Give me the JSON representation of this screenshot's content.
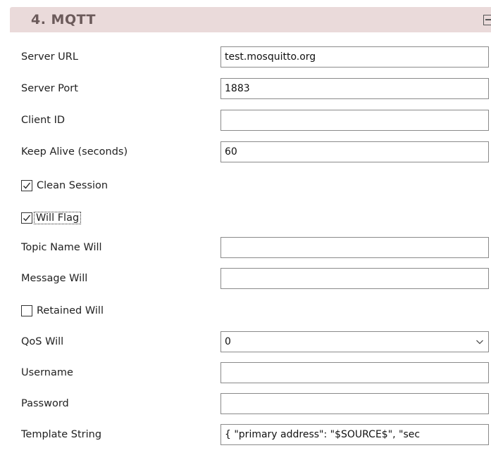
{
  "section": {
    "title": "4. MQTT",
    "collapse_icon": "collapse-icon"
  },
  "fields": {
    "server_url": {
      "label": "Server URL",
      "value": "test.mosquitto.org"
    },
    "server_port": {
      "label": "Server Port",
      "value": "1883"
    },
    "client_id": {
      "label": "Client ID",
      "value": ""
    },
    "keep_alive": {
      "label": "Keep Alive (seconds)",
      "value": "60"
    },
    "clean_session": {
      "label": "Clean Session",
      "checked": true
    },
    "will_flag": {
      "label": "Will Flag",
      "checked": true
    },
    "topic_name_will": {
      "label": "Topic Name Will",
      "value": ""
    },
    "message_will": {
      "label": "Message Will",
      "value": ""
    },
    "retained_will": {
      "label": "Retained Will",
      "checked": false
    },
    "qos_will": {
      "label": "QoS Will",
      "value": "0"
    },
    "username": {
      "label": "Username",
      "value": ""
    },
    "password": {
      "label": "Password",
      "value": ""
    },
    "template_string": {
      "label": "Template String",
      "value": "{ \"primary address\": \"$SOURCE$\",  \"sec"
    }
  },
  "colors": {
    "header_bg": "#eadada",
    "header_text": "#6b5a5a",
    "field_border": "#8a8a8a"
  }
}
